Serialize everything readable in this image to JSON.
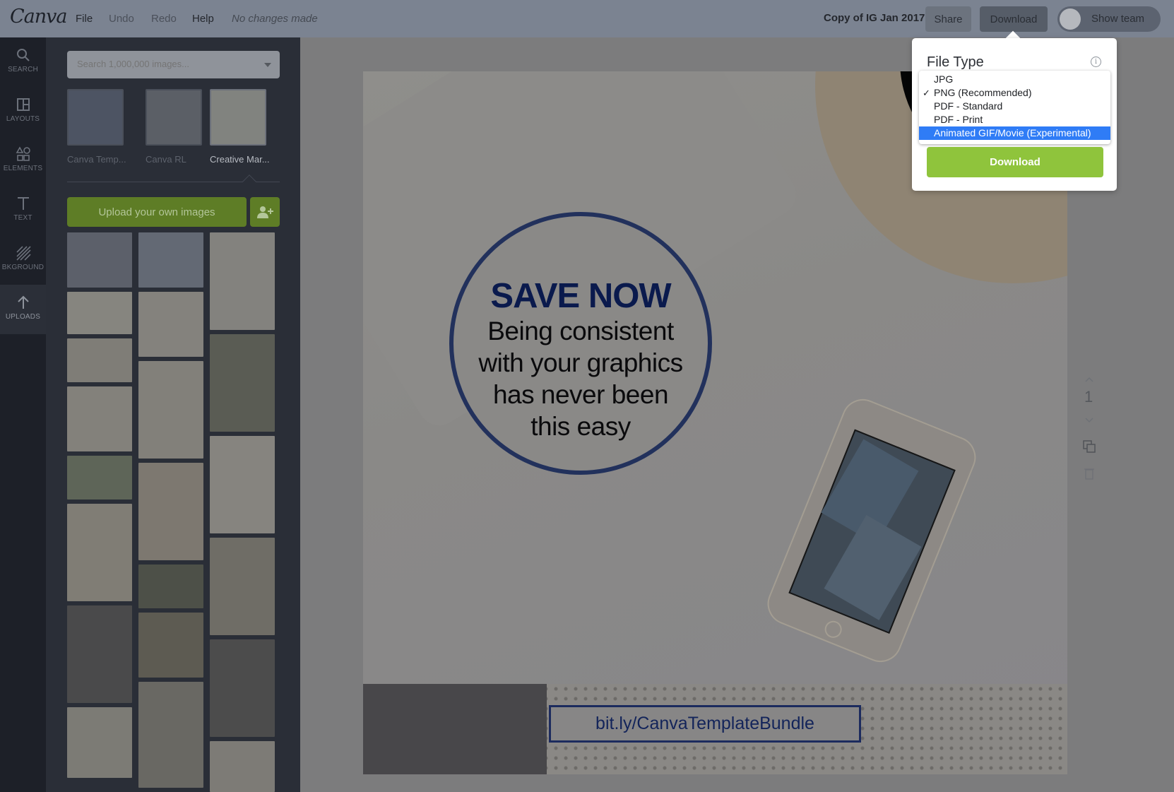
{
  "app": {
    "logo": "Canva"
  },
  "menu": {
    "file": "File",
    "undo": "Undo",
    "redo": "Redo",
    "help": "Help",
    "status": "No changes made"
  },
  "header": {
    "doc_title": "Copy of IG Jan 2017",
    "share": "Share",
    "download": "Download",
    "show_team": "Show team"
  },
  "rail": {
    "items": [
      {
        "label": "SEARCH",
        "icon": "search-icon"
      },
      {
        "label": "LAYOUTS",
        "icon": "layouts-icon"
      },
      {
        "label": "ELEMENTS",
        "icon": "elements-icon"
      },
      {
        "label": "TEXT",
        "icon": "text-icon"
      },
      {
        "label": "BKGROUND",
        "icon": "background-icon"
      },
      {
        "label": "UPLOADS",
        "icon": "upload-icon",
        "active": true
      }
    ]
  },
  "panel": {
    "search_placeholder": "Search 1,000,000 images...",
    "folders": [
      {
        "label": "Canva Temp..."
      },
      {
        "label": "Canva RL"
      },
      {
        "label": "Creative Mar...",
        "active": true
      }
    ],
    "upload_button": "Upload your own images"
  },
  "design": {
    "headline": "SAVE NOW",
    "body_lines": [
      "Being consistent",
      "with your graphics",
      "has never been",
      "this easy"
    ],
    "link": "bit.ly/CanvaTemplateBundle"
  },
  "page_tools": {
    "page_number": "1"
  },
  "download_popover": {
    "title": "File Type",
    "options": [
      {
        "label": "JPG",
        "checked": false,
        "highlighted": false
      },
      {
        "label": "PNG (Recommended)",
        "checked": true,
        "highlighted": false
      },
      {
        "label": "PDF - Standard",
        "checked": false,
        "highlighted": false
      },
      {
        "label": "PDF - Print",
        "checked": false,
        "highlighted": false
      },
      {
        "label": "Animated GIF/Movie (Experimental)",
        "checked": false,
        "highlighted": true
      }
    ],
    "download_button": "Download"
  },
  "colors": {
    "accent_green": "#8fc43c",
    "selection_blue": "#2f7cf6",
    "headline_navy": "#0a1a4d"
  }
}
